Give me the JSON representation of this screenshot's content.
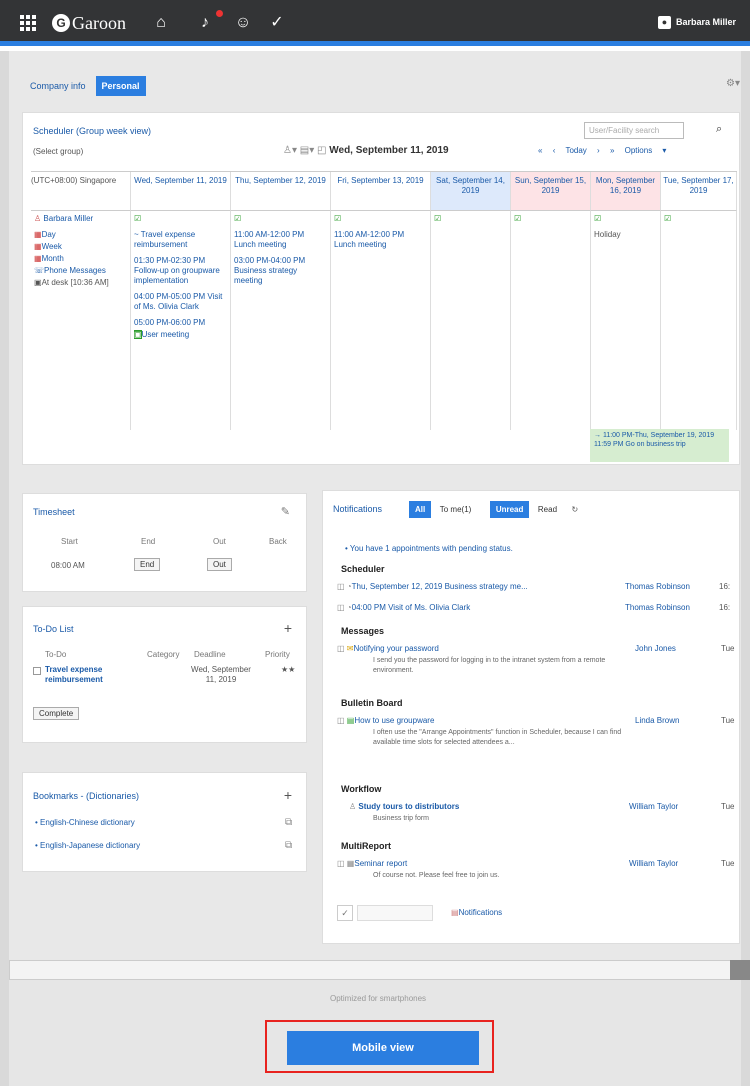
{
  "topbar": {
    "app_name": "Garoon",
    "user": "Barbara Miller"
  },
  "tabs": [
    "Company info",
    "Personal"
  ],
  "scheduler": {
    "title": "Scheduler (Group week view)",
    "search_placeholder": "User/Facility search",
    "group_select": "(Select group)",
    "date": "Wed, September 11, 2019",
    "nav": [
      "«",
      "‹",
      "Today",
      "›",
      "»",
      "Options ▾"
    ],
    "timezone": "(UTC+08:00) Singapore",
    "days": [
      "Wed, September 11, 2019",
      "Thu, September 12, 2019",
      "Fri, September 13, 2019",
      "Sat, September 14, 2019",
      "Sun, September 15, 2019",
      "Mon, September 16, 2019",
      "Tue, September 17, 2019"
    ],
    "user_name": "Barbara Miller",
    "user_links": [
      "Day",
      "Week",
      "Month",
      "Phone Messages",
      "At desk [10:36 AM]"
    ],
    "wed_events": [
      "~ Travel expense reimbursement",
      "01:30 PM-02:30 PM Follow-up on groupware implementation",
      "04:00 PM-05:00 PM Visit of Ms. Olivia Clark",
      "05:00 PM-06:00 PM",
      "User meeting"
    ],
    "thu_events": [
      "11:00 AM-12:00 PM Lunch meeting",
      "03:00 PM-04:00 PM Business strategy meeting"
    ],
    "fri_events": [
      "11:00 AM-12:00 PM Lunch meeting"
    ],
    "mon_event": "Holiday",
    "green_event": "→ 11:00 PM-Thu, September 19, 2019 11:59 PM Go on business trip"
  },
  "timesheet": {
    "title": "Timesheet",
    "headers": [
      "Start",
      "End",
      "Out",
      "Back"
    ],
    "start_value": "08:00 AM",
    "end_btn": "End",
    "out_btn": "Out"
  },
  "todo": {
    "title": "To-Do List",
    "headers": [
      "To-Do",
      "Category",
      "Deadline",
      "Priority"
    ],
    "item": "Travel expense reimbursement",
    "deadline": "Wed, September 11, 2019",
    "priority": "★★",
    "complete": "Complete"
  },
  "bookmarks": {
    "title": "Bookmarks - (Dictionaries)",
    "items": [
      "English-Chinese dictionary",
      "English-Japanese dictionary"
    ]
  },
  "notifications": {
    "title": "Notifications",
    "filters": [
      "All",
      "To me(1)",
      "Unread",
      "Read"
    ],
    "pending": "You have 1 appointments with pending status.",
    "sections": {
      "scheduler": "Scheduler",
      "messages": "Messages",
      "bulletin": "Bulletin Board",
      "workflow": "Workflow",
      "multireport": "MultiReport"
    },
    "items": {
      "sched1": "Thu, September 12, 2019 Business strategy me...",
      "sched2": "04:00 PM Visit of Ms. Olivia Clark",
      "msg": "Notifying your password",
      "msg_sub": "I send you the password for logging in to the intranet system from a remote environment.",
      "bb": "How to use groupware",
      "bb_sub": "I often use the \"Arrange Appointments\" function in Scheduler, because I can find available time slots for selected attendees a...",
      "wf": "Study tours to distributors",
      "wf_sub": "Business trip form",
      "mr": "Seminar report",
      "mr_sub": "Of course not. Please feel free to join us."
    },
    "who": [
      "Thomas Robinson",
      "Thomas Robinson",
      "John Jones",
      "Linda Brown",
      "William Taylor",
      "William Taylor"
    ],
    "time": [
      "16:",
      "16:",
      "Tue",
      "Tue",
      "Tue",
      "Tue"
    ],
    "footer_link": "Notifications"
  },
  "mobile": {
    "caption": "Optimized for smartphones",
    "button": "Mobile view"
  }
}
